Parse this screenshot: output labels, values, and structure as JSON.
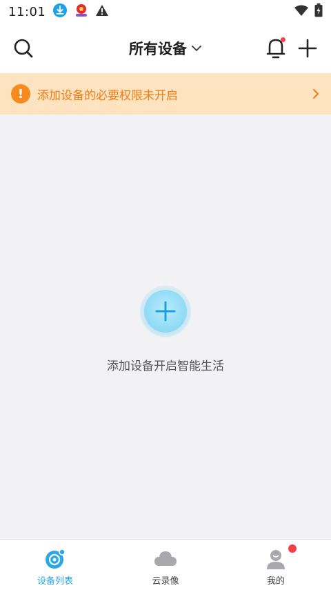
{
  "status_bar": {
    "time": "11:01",
    "left_icons": [
      "download-icon",
      "app-notification-icon",
      "warning-icon"
    ],
    "right_icons": [
      "wifi-icon",
      "battery-icon"
    ]
  },
  "header": {
    "title": "所有设备",
    "icons": [
      "search-icon",
      "chevron-down-icon",
      "bell-icon",
      "plus-icon"
    ],
    "notification_dot_color": "#f0404a"
  },
  "banner": {
    "text": "添加设备的必要权限未开启",
    "icon": "!",
    "text_color": "#f07c15",
    "background": "#fde3c0"
  },
  "empty_state": {
    "text": "添加设备开启智能生活",
    "button_icon": "plus-icon",
    "accent": "#2aa7e6"
  },
  "tabbar": {
    "tabs": [
      {
        "label": "设备列表",
        "icon": "camera-icon",
        "active": true
      },
      {
        "label": "云录像",
        "icon": "cloud-icon",
        "active": false
      },
      {
        "label": "我的",
        "icon": "user-icon",
        "active": false,
        "badge": true
      }
    ]
  }
}
